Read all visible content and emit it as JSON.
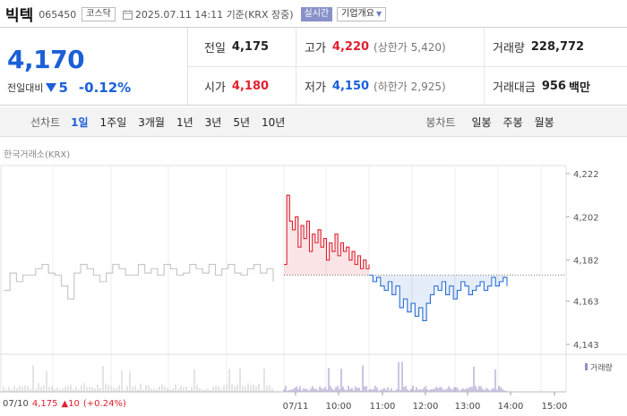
{
  "header": {
    "name": "빅텍",
    "code": "065450",
    "market": "코스닥",
    "timestamp": "2025.07.11 14:11 기준(KRX 장중)",
    "live_label": "실시간",
    "info_label": "기업개요"
  },
  "price": {
    "current": "4,170",
    "change_label": "전일대비",
    "change_amount": "5",
    "change_pct": "-0.12%",
    "color_down": "#1b5fd8",
    "color_up": "#e0202f"
  },
  "stats": {
    "prev_label": "전일",
    "prev": "4,175",
    "high_label": "고가",
    "high": "4,220",
    "upper_limit": "(상한가 5,420)",
    "volume_label": "거래량",
    "volume": "228,772",
    "open_label": "시가",
    "open": "4,180",
    "low_label": "저가",
    "low": "4,150",
    "lower_limit": "(하한가 2,925)",
    "value_label": "거래대금",
    "value": "956",
    "value_unit": "백만"
  },
  "periods": {
    "line_title": "선차트",
    "line_options": [
      "1일",
      "1주일",
      "3개월",
      "1년",
      "3년",
      "5년",
      "10년"
    ],
    "selected": "1일",
    "candle_title": "봉차트",
    "candle_options": [
      "일봉",
      "주봉",
      "월봉"
    ]
  },
  "chart_source": "한국거래소(KRX)",
  "chart_data": {
    "type": "line",
    "y_ticks": [
      "4,222",
      "4,202",
      "4,182",
      "4,163",
      "4,143"
    ],
    "ylim": [
      4143,
      4222
    ],
    "prev_close": 4175,
    "x_ticks": [
      "07/11",
      "10:00",
      "11:00",
      "12:00",
      "13:00",
      "14:00",
      "15:00"
    ],
    "volume_label": "거래량",
    "series": [
      {
        "values": [
          4168,
          4176,
          4172,
          4175,
          4175,
          4178,
          4180,
          4176,
          4175,
          4170,
          4164,
          4176,
          4180,
          4178,
          4175,
          4172,
          4176,
          4180,
          4178,
          4175,
          4175,
          4180,
          4176,
          4178,
          4175,
          4180,
          4178,
          4175,
          4176,
          4180,
          4178,
          4176,
          4180,
          4175,
          4178,
          4180,
          4176,
          4175,
          4178,
          4180,
          4176,
          4178,
          4172
        ]
      },
      {
        "values": [
          4180,
          4212,
          4200,
          4196,
          4202,
          4188,
          4198,
          4192,
          4200,
          4186,
          4194,
          4190,
          4196,
          4188,
          4192,
          4182,
          4190,
          4186,
          4194,
          4184,
          4190,
          4186,
          4188,
          4182,
          4186,
          4180,
          4184,
          4178,
          4182,
          4178,
          4180
        ]
      },
      {
        "values": [
          4175,
          4172,
          4174,
          4170,
          4168,
          4172,
          4166,
          4170,
          4160,
          4164,
          4158,
          4162,
          4156,
          4160,
          4154,
          4162,
          4166,
          4170,
          4168,
          4172,
          4166,
          4170,
          4164,
          4168,
          4172,
          4170,
          4166,
          4168,
          4170,
          4172,
          4168,
          4170,
          4174,
          4170,
          4172,
          4174,
          4170
        ]
      }
    ],
    "prev_day": {
      "date": "07/10",
      "close": "4,175",
      "change": "10",
      "change_pct": "(+0.24%)"
    }
  }
}
